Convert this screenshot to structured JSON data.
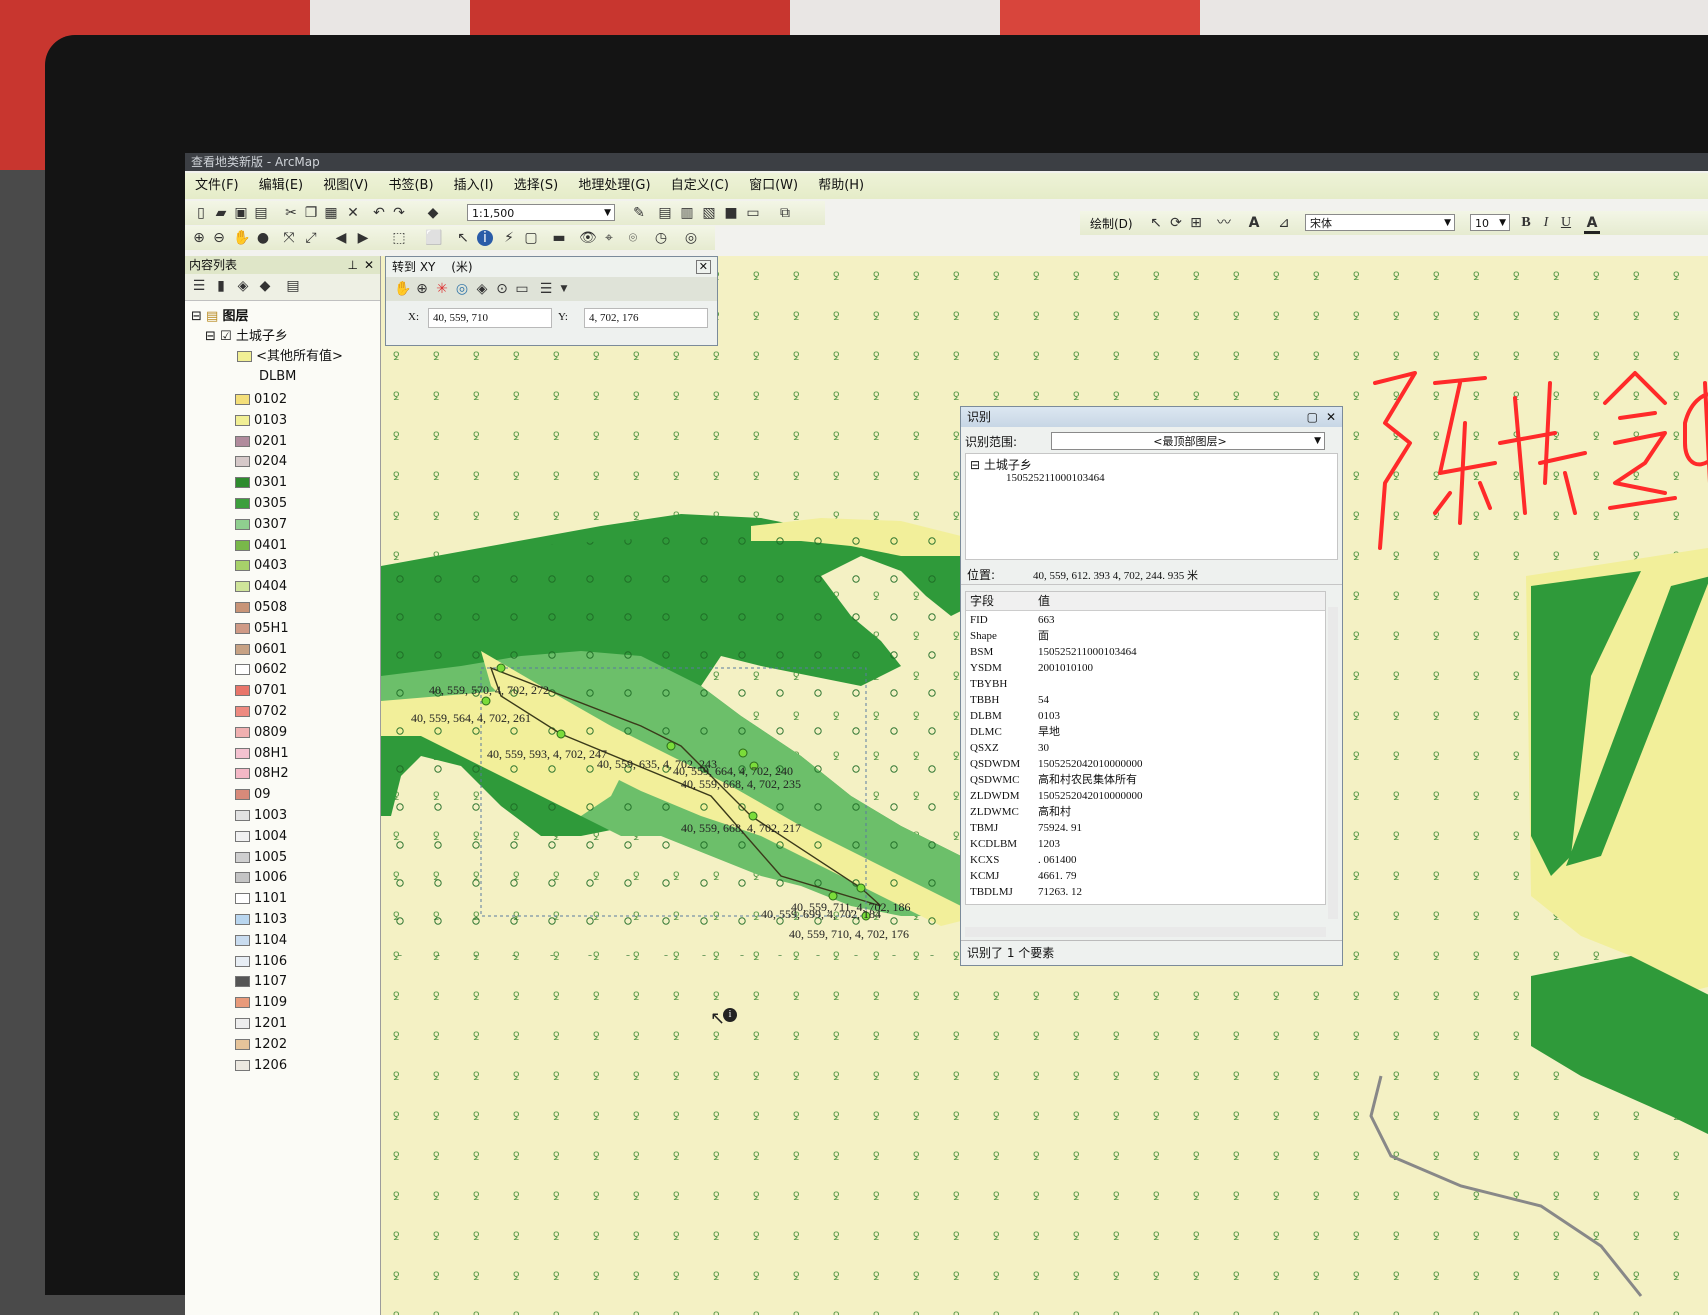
{
  "window": {
    "title": "查看地类新版 - ArcMap"
  },
  "menu": [
    "文件(F)",
    "编辑(E)",
    "视图(V)",
    "书签(B)",
    "插入(I)",
    "选择(S)",
    "地理处理(G)",
    "自定义(C)",
    "窗口(W)",
    "帮助(H)"
  ],
  "toolbar": {
    "scale": "1:1,500",
    "draw_label": "绘制(D)",
    "font_name": "宋体",
    "font_size": "10",
    "bold": "B",
    "italic": "I",
    "underline": "U",
    "font_color": "A"
  },
  "toc": {
    "title": "内容列表",
    "root": "图层",
    "layer": "土城子乡",
    "other_values": "<其他所有值>",
    "field": "DLBM",
    "codes": [
      {
        "code": "0102",
        "color": "#f4df7a"
      },
      {
        "code": "0103",
        "color": "#f1ef95"
      },
      {
        "code": "0201",
        "color": "#b08b9c"
      },
      {
        "code": "0204",
        "color": "#d6c9c9"
      },
      {
        "code": "0301",
        "color": "#2e8b2e"
      },
      {
        "code": "0305",
        "color": "#3c9e3c"
      },
      {
        "code": "0307",
        "color": "#8fcf8f"
      },
      {
        "code": "0401",
        "color": "#79b84a"
      },
      {
        "code": "0403",
        "color": "#a7d16a"
      },
      {
        "code": "0404",
        "color": "#cfe49a"
      },
      {
        "code": "0508",
        "color": "#c89477"
      },
      {
        "code": "05H1",
        "color": "#cf9a86"
      },
      {
        "code": "0601",
        "color": "#c7a284"
      },
      {
        "code": "0602",
        "color": "#ffffff"
      },
      {
        "code": "0701",
        "color": "#e8756a"
      },
      {
        "code": "0702",
        "color": "#ee8a80"
      },
      {
        "code": "0809",
        "color": "#f0b0b0"
      },
      {
        "code": "08H1",
        "color": "#f4c2d0"
      },
      {
        "code": "08H2",
        "color": "#f4b8c6"
      },
      {
        "code": "09",
        "color": "#d88a7a"
      },
      {
        "code": "1003",
        "color": "#e2e2e2"
      },
      {
        "code": "1004",
        "color": "#f1f1f1"
      },
      {
        "code": "1005",
        "color": "#cfcfcf"
      },
      {
        "code": "1006",
        "color": "#c4c4c4"
      },
      {
        "code": "1101",
        "color": "#ffffff"
      },
      {
        "code": "1103",
        "color": "#b9d6ef"
      },
      {
        "code": "1104",
        "color": "#c9dcef"
      },
      {
        "code": "1106",
        "color": "#e8eef4"
      },
      {
        "code": "1107",
        "color": "#555555"
      },
      {
        "code": "1109",
        "color": "#e89a7a"
      },
      {
        "code": "1201",
        "color": "#eeeeee"
      },
      {
        "code": "1202",
        "color": "#e6c49a"
      },
      {
        "code": "1206",
        "color": "#ece8e0"
      }
    ]
  },
  "goto_xy": {
    "title": "转到 XY",
    "unit": "(米)",
    "x_label": "X:",
    "x_value": "40, 559, 710",
    "y_label": "Y:",
    "y_value": "4, 702, 176"
  },
  "map_labels": [
    "40, 559, 570, 4, 702, 272",
    "40, 559, 564, 4, 702, 261",
    "40, 559, 593, 4, 702, 247",
    "40, 559, 635, 4, 702, 243",
    "40, 559, 664, 4, 702, 240",
    "40, 559, 668, 4, 702, 235",
    "40, 559, 668, 4, 702, 217",
    "40, 559, 711, 4, 702, 186",
    "40, 559, 699, 4, 702, 184",
    "40, 559, 710, 4, 702, 176"
  ],
  "identify": {
    "title": "识别",
    "scope_label": "识别范围:",
    "scope_value": "<最顶部图层>",
    "tree_layer": "土城子乡",
    "tree_feature": "150525211000103464",
    "location_label": "位置:",
    "location_value": "40, 559, 612. 393   4, 702, 244. 935 米",
    "col_field": "字段",
    "col_value": "值",
    "rows": [
      {
        "k": "FID",
        "v": "663"
      },
      {
        "k": "Shape",
        "v": "面"
      },
      {
        "k": "BSM",
        "v": "150525211000103464"
      },
      {
        "k": "YSDM",
        "v": "2001010100"
      },
      {
        "k": "TBYBH",
        "v": ""
      },
      {
        "k": "TBBH",
        "v": "54"
      },
      {
        "k": "DLBM",
        "v": "0103"
      },
      {
        "k": "DLMC",
        "v": "旱地"
      },
      {
        "k": "QSXZ",
        "v": "30"
      },
      {
        "k": "QSDWDM",
        "v": "1505252042010000000"
      },
      {
        "k": "QSDWMC",
        "v": "高和村农民集体所有"
      },
      {
        "k": "ZLDWDM",
        "v": "1505252042010000000"
      },
      {
        "k": "ZLDWMC",
        "v": "高和村"
      },
      {
        "k": "TBMJ",
        "v": "75924. 91"
      },
      {
        "k": "KCDLBM",
        "v": "1203"
      },
      {
        "k": "KCXS",
        "v": ". 061400"
      },
      {
        "k": "KCMJ",
        "v": "4661. 79"
      },
      {
        "k": "TBDLMJ",
        "v": "71263. 12"
      }
    ],
    "status": "识别了 1 个要素"
  },
  "colors": {
    "forest_dark": "#2f9a3a",
    "forest_light": "#6cbf6a",
    "farmland": "#f2ef9a",
    "grassland": "#eef0c4",
    "ink": "#ff2a2a"
  }
}
